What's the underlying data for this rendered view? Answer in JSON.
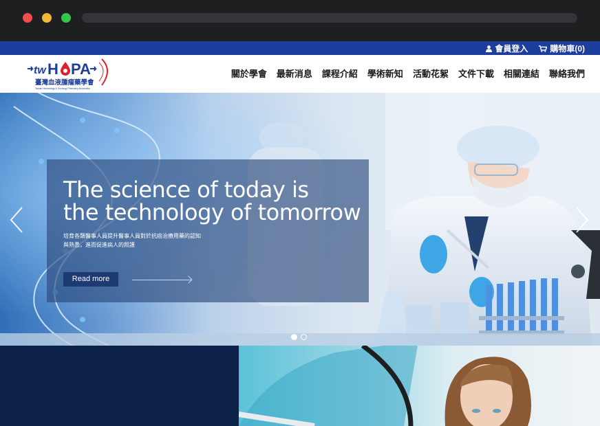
{
  "browser": {
    "dots": [
      "red",
      "yellow",
      "green"
    ]
  },
  "topbar": {
    "member_login": "會員登入",
    "cart": "購物車(0)",
    "icons": [
      "user-icon",
      "cart-icon"
    ]
  },
  "logo": {
    "main": "twHOPA",
    "chinese": "臺灣血液腫瘤藥學會",
    "english": "Taiwan Hematology & Oncology Pharmacy Association"
  },
  "nav": {
    "items": [
      "關於學會",
      "最新消息",
      "課程介紹",
      "學術新知",
      "活動花絮",
      "文件下載",
      "相關連結",
      "聯絡我們"
    ]
  },
  "hero": {
    "title_line1": "The science of today is",
    "title_line2": "the technology of tomorrow",
    "subtitle_line1": "培育各類醫事人員提升醫事人員對於抗癌治療用藥的認知",
    "subtitle_line2": "與熟悉，進而促進病人的照護",
    "read_more": "Read more",
    "slide_count": 2,
    "active_slide": 1
  },
  "colors": {
    "topbar": "#1d3e9c",
    "dark_panel": "#0d2249",
    "logo_blue": "#1d3e9c",
    "logo_red": "#d9232e"
  }
}
